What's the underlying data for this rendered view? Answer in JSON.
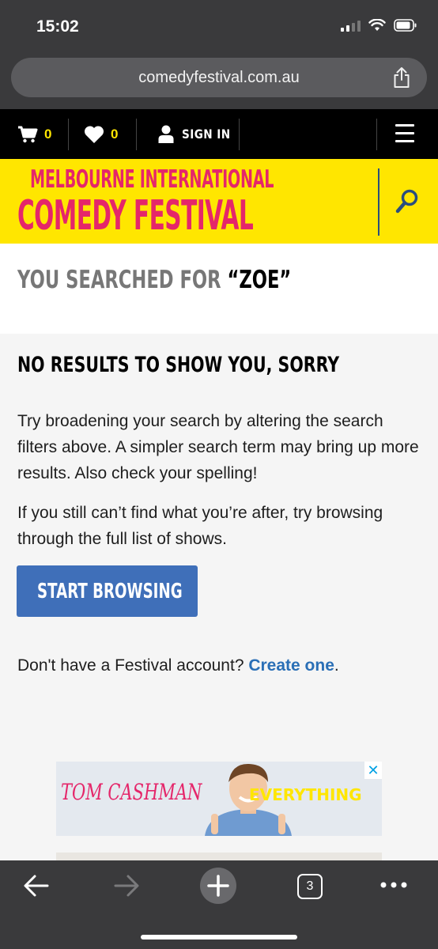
{
  "status_bar": {
    "time": "15:02"
  },
  "browser": {
    "url": "comedyfestival.com.au",
    "tab_count": "3"
  },
  "nav": {
    "cart_count": "0",
    "wishlist_count": "0",
    "sign_in_label": "SIGN IN"
  },
  "banner": {
    "logo_line1": "MELBOURNE INTERNATIONAL",
    "logo_line2": "COMEDY FESTIVAL"
  },
  "search": {
    "prefix": "YOU SEARCHED FOR ",
    "term": "“ZOE”"
  },
  "results": {
    "heading": "NO RESULTS TO SHOW YOU, SORRY",
    "paragraph1": "Try broadening your search by altering the search filters above. A simpler search term may bring up more results. Also check your spelling!",
    "paragraph2": "If you still can’t find what you’re after, try browsing through the full list of shows.",
    "button_label": "START BROWSING",
    "account_text": "Don't have a Festival account? ",
    "account_link": "Create one",
    "account_suffix": "."
  },
  "ad": {
    "name": "TOM CASHMAN",
    "tagline": "EVERYTHING",
    "close_glyph": "✕"
  },
  "colors": {
    "brand_yellow": "#ffe600",
    "brand_pink": "#e5266a",
    "button_blue": "#3f6fb9",
    "link_blue": "#2a6fb6",
    "navy": "#2a4e7e"
  }
}
